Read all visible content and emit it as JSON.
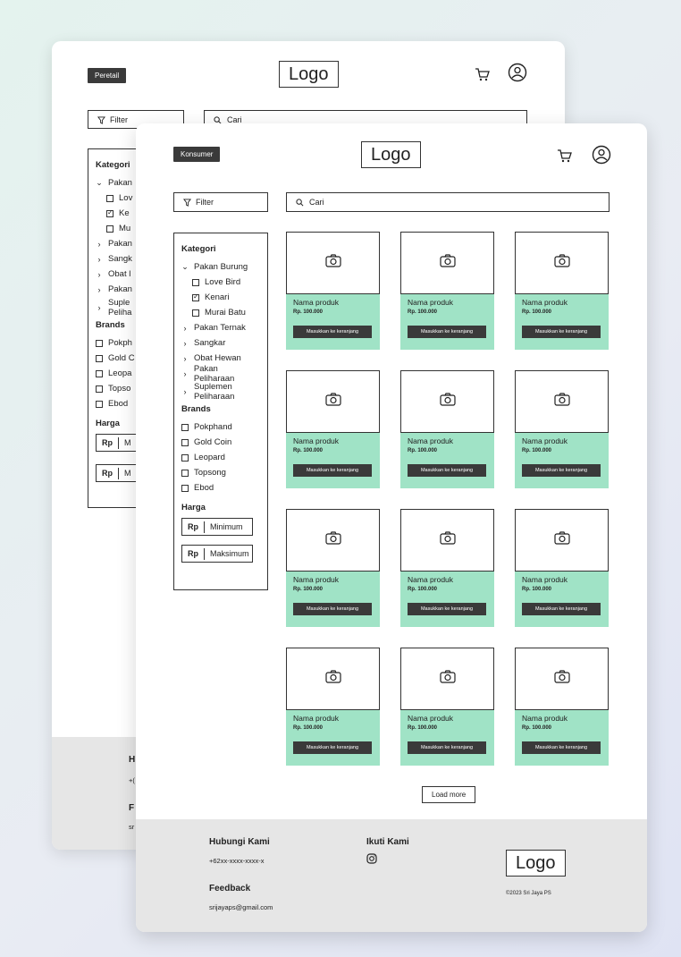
{
  "back": {
    "badge": "Peretail",
    "logo": "Logo",
    "filter": "Filter",
    "search_placeholder": "Cari",
    "kategori_title": "Kategori",
    "items": [
      "Pakan",
      "Lov",
      "Ke",
      "Mu",
      "Pakan",
      "Sangk",
      "Obat l",
      "Pakan",
      "Suple",
      "Peliha"
    ],
    "brands_title": "Brands",
    "brands": [
      "Pokph",
      "Gold C",
      "Leopa",
      "Topso",
      "Ebod"
    ],
    "harga_title": "Harga",
    "price_prefix": "Rp",
    "price_short": "M",
    "footer_h": "H",
    "footer_plus": "+(",
    "footer_f": "F",
    "footer_sr": "sr"
  },
  "front": {
    "badge": "Konsumer",
    "logo": "Logo",
    "filter": "Filter",
    "search_placeholder": "Cari",
    "sidebar": {
      "kategori_title": "Kategori",
      "pakan_burung": "Pakan Burung",
      "sub_items": [
        {
          "label": "Love Bird",
          "checked": false
        },
        {
          "label": "Kenari",
          "checked": true
        },
        {
          "label": "Murai Batu",
          "checked": false
        }
      ],
      "other_categories": [
        "Pakan Ternak",
        "Sangkar",
        "Obat Hewan",
        "Pakan Peliharaan"
      ],
      "suplemen_1": "Suplemen",
      "suplemen_2": "Peliharaan",
      "brands_title": "Brands",
      "brands": [
        "Pokphand",
        "Gold Coin",
        "Leopard",
        "Topsong",
        "Ebod"
      ],
      "harga_title": "Harga",
      "price_prefix": "Rp",
      "min": "Minimum",
      "max": "Maksimum"
    },
    "product": {
      "name": "Nama produk",
      "price": "Rp. 100.000",
      "button": "Masukkan ke keranjang"
    },
    "load_more": "Load more",
    "footer": {
      "contact_title": "Hubungi Kami",
      "phone": "+62xx-xxxx-xxxx-x",
      "feedback_title": "Feedback",
      "email": "srijayaps@gmail.com",
      "follow_title": "Ikuti Kami",
      "logo": "Logo",
      "copyright": "©2023 Sri Jaya PS"
    }
  },
  "icons": [
    "filter-icon",
    "search-icon",
    "cart-icon",
    "user-icon",
    "camera-icon",
    "instagram-icon"
  ]
}
